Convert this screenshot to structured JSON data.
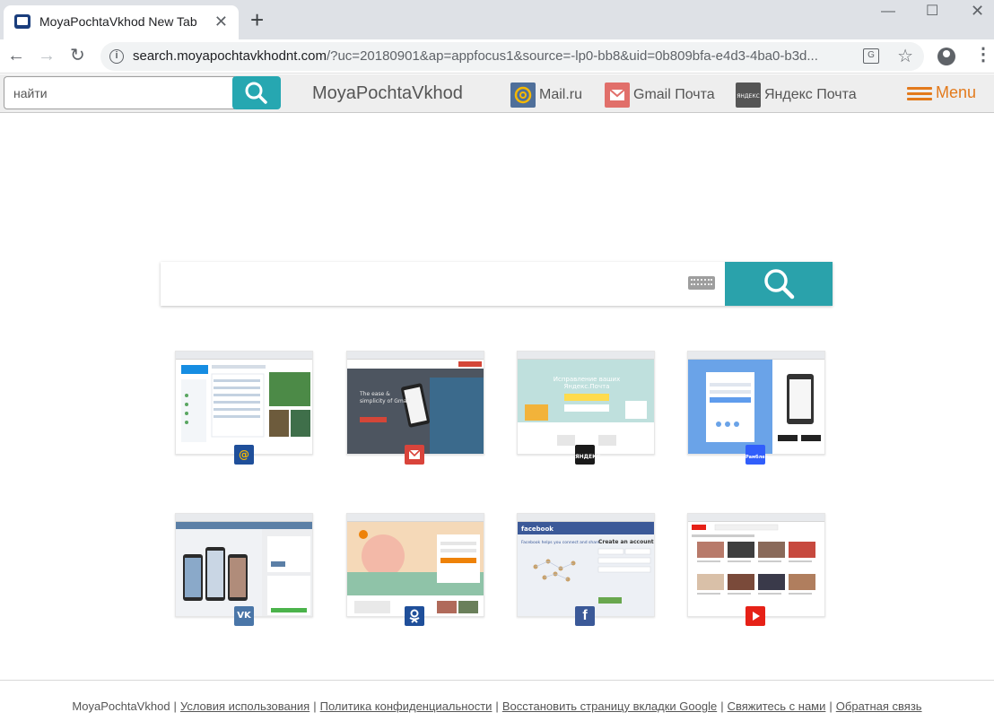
{
  "browser": {
    "tab_title": "MoyaPochtaVkhod New Tab",
    "url_host": "search.moyapochtavkhodnt.com",
    "url_rest": "/?uc=20180901&ap=appfocus1&source=-lp0-bb8&uid=0b809bfa-e4d3-4ba0-b3d..."
  },
  "header": {
    "search_placeholder": "найти",
    "brand": "MoyaPochtaVkhod",
    "links": [
      {
        "label": "Mail.ru",
        "icon": "mailru-icon",
        "color": "#4f6f9a"
      },
      {
        "label": "Gmail Почта",
        "icon": "gmail-icon",
        "color": "#e16f6a"
      },
      {
        "label": "Яндекс Почта",
        "icon": "yandex-icon",
        "color": "#555555"
      }
    ],
    "menu_label": "Menu",
    "accent_color": "#e37a1c"
  },
  "main": {
    "search_button_color": "#2aa2ab"
  },
  "tiles": [
    {
      "name": "mail.ru",
      "icon": "mailru-icon",
      "badge_color": "#1f4f9a"
    },
    {
      "name": "gmail",
      "icon": "gmail-icon",
      "badge_color": "#d9443b"
    },
    {
      "name": "yandex-mail",
      "icon": "yandex-icon",
      "badge_color": "#1a1a1a",
      "badge_text": "ЯНДЕКС"
    },
    {
      "name": "rambler",
      "icon": "rambler-icon",
      "badge_color": "#315efb",
      "badge_text": "Рамблер"
    },
    {
      "name": "vk",
      "icon": "vk-icon",
      "badge_color": "#4a76a8",
      "badge_text": "VK"
    },
    {
      "name": "odnoklassniki",
      "icon": "ok-icon",
      "badge_color": "#1f4f9a"
    },
    {
      "name": "facebook",
      "icon": "facebook-icon",
      "badge_color": "#3b5998",
      "badge_text": "f"
    },
    {
      "name": "youtube",
      "icon": "youtube-icon",
      "badge_color": "#e62117"
    }
  ],
  "footer": {
    "brand": "MoyaPochtaVkhod",
    "links": [
      "Условия использования",
      "Политика конфиденциальности",
      "Восстановить страницу вкладки Google",
      "Свяжитесь с нами",
      "Обратная связь"
    ]
  }
}
